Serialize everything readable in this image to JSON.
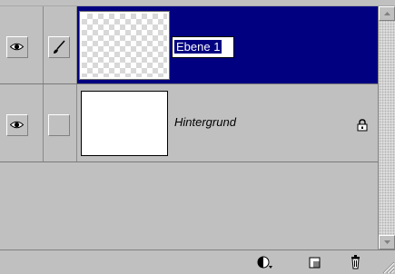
{
  "window": {
    "title": ""
  },
  "layers": [
    {
      "name_value": "Ebene 1",
      "visible_icon": "eye-icon",
      "edit_icon": "brush-icon",
      "thumbnail": "transparent",
      "selected": true,
      "editing_name": true
    },
    {
      "name": "Hintergrund",
      "visible_icon": "eye-icon",
      "thumbnail": "white",
      "locked": true,
      "lock_icon": "lock-icon"
    }
  ],
  "toolbar": {
    "buttons": [
      {
        "icon": "adjustment-layer-icon"
      },
      {
        "icon": "new-layer-icon"
      },
      {
        "icon": "trash-icon"
      }
    ]
  },
  "colors": {
    "selection": "#000080",
    "panel": "#c0c0c0"
  }
}
